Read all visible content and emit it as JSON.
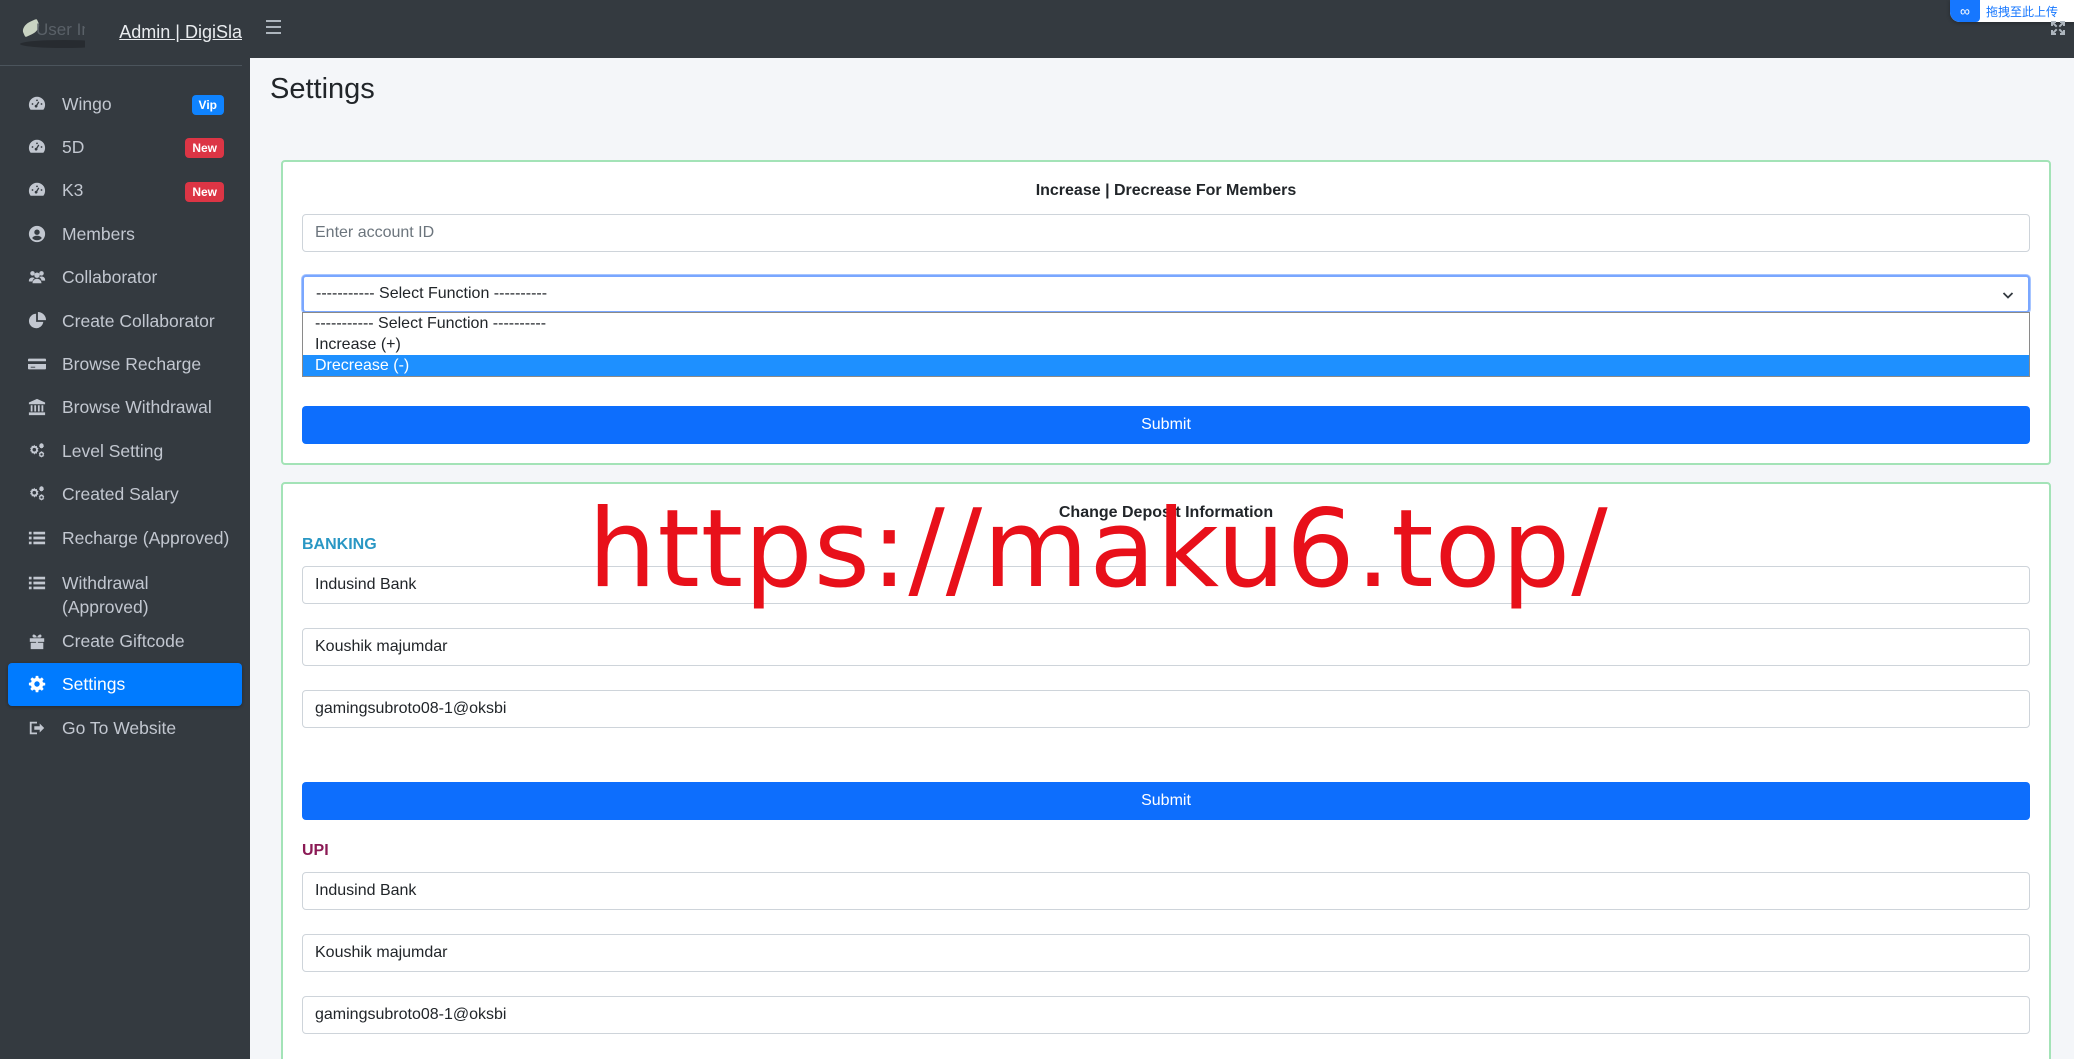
{
  "brand": {
    "image_alt": "User Imag",
    "text": "Admin | DigiSla"
  },
  "sidebar": {
    "items": [
      {
        "label": "Wingo",
        "icon": "dashboard-icon",
        "badge": "Vip",
        "badge_color": "#0f83ff"
      },
      {
        "label": "5D",
        "icon": "dashboard-icon",
        "badge": "New",
        "badge_color": "#dc3545"
      },
      {
        "label": "K3",
        "icon": "dashboard-icon",
        "badge": "New",
        "badge_color": "#dc3545"
      },
      {
        "label": "Members",
        "icon": "user-circle-icon"
      },
      {
        "label": "Collaborator",
        "icon": "users-icon"
      },
      {
        "label": "Create Collaborator",
        "icon": "pie-chart-icon"
      },
      {
        "label": "Browse Recharge",
        "icon": "credit-card-icon"
      },
      {
        "label": "Browse Withdrawal",
        "icon": "bank-icon"
      },
      {
        "label": "Level Setting",
        "icon": "cogs-icon"
      },
      {
        "label": "Created Salary",
        "icon": "cogs-icon"
      },
      {
        "label": "Recharge (Approved)",
        "icon": "list-icon"
      },
      {
        "label": "Withdrawal (Approved)",
        "icon": "list-icon"
      },
      {
        "label": "Create Giftcode",
        "icon": "gift-icon"
      },
      {
        "label": "Settings",
        "icon": "gear-icon",
        "active": true
      },
      {
        "label": "Go To Website",
        "icon": "sign-out-icon"
      }
    ],
    "active_color": "#007bff"
  },
  "topbar": {
    "upload_widget_text": "拖拽至此上传"
  },
  "page": {
    "title": "Settings"
  },
  "member_adjust": {
    "title": "Increase | Drecrease For Members",
    "account_placeholder": "Enter account ID",
    "select_value": "----------- Select Function ----------",
    "options": [
      "----------- Select Function ----------",
      "Increase (+)",
      "Drecrease (-)"
    ],
    "highlighted_option": "Drecrease (-)",
    "submit_label": "Submit"
  },
  "deposit_info": {
    "title": "Change Deposit Information",
    "banking": {
      "label": "BANKING",
      "bank_name": "Indusind Bank",
      "holder_name": "Koushik majumdar",
      "upi_id": "gamingsubroto08-1@oksbi",
      "submit_label": "Submit"
    },
    "upi": {
      "label": "UPI",
      "bank_name": "Indusind Bank",
      "holder_name": "Koushik majumdar",
      "upi_id": "gamingsubroto08-1@oksbi"
    }
  },
  "watermark": {
    "text": "https://maku6.top/",
    "color": "#e8101a"
  },
  "colors": {
    "primary_button": "#0d6efd",
    "card_border": "#a3e3b7",
    "sidebar_bg": "#343a40"
  }
}
